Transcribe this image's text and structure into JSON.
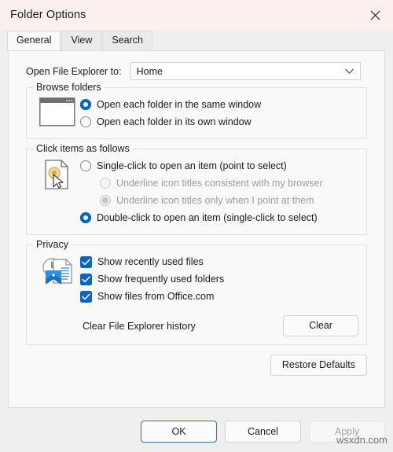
{
  "window": {
    "title": "Folder Options",
    "close_icon": "close-icon",
    "titlebar_color": "#fbf0ee"
  },
  "tabs": [
    {
      "label": "General",
      "active": true
    },
    {
      "label": "View",
      "active": false
    },
    {
      "label": "Search",
      "active": false
    }
  ],
  "general": {
    "open_explorer": {
      "label": "Open File Explorer to:",
      "value": "Home",
      "chevron_icon": "chevron-down-icon"
    },
    "browse_folders": {
      "legend": "Browse folders",
      "icon": "window-folder-icon",
      "options": [
        {
          "label": "Open each folder in the same window",
          "checked": true,
          "disabled": false
        },
        {
          "label": "Open each folder in its own window",
          "checked": false,
          "disabled": false
        }
      ]
    },
    "click_items": {
      "legend": "Click items as follows",
      "icon": "document-pointer-icon",
      "options": [
        {
          "label": "Single-click to open an item (point to select)",
          "checked": false,
          "disabled": false,
          "indent": false
        },
        {
          "label": "Underline icon titles consistent with my browser",
          "checked": false,
          "disabled": true,
          "indent": true
        },
        {
          "label": "Underline icon titles only when I point at them",
          "checked": true,
          "disabled": true,
          "indent": true
        },
        {
          "label": "Double-click to open an item (single-click to select)",
          "checked": true,
          "disabled": false,
          "indent": false
        }
      ]
    },
    "privacy": {
      "legend": "Privacy",
      "icon": "recent-files-pin-icon",
      "checkboxes": [
        {
          "label": "Show recently used files",
          "checked": true
        },
        {
          "label": "Show frequently used folders",
          "checked": true
        },
        {
          "label": "Show files from Office.com",
          "checked": true
        }
      ],
      "clear_history": {
        "label": "Clear File Explorer history",
        "button": "Clear"
      }
    },
    "restore_defaults": "Restore Defaults"
  },
  "footer": {
    "ok": "OK",
    "cancel": "Cancel",
    "apply": "Apply",
    "apply_disabled": true
  },
  "watermark": "wsxdn.com",
  "colors": {
    "accent": "#0a64c2",
    "panel": "#f9f9f9",
    "dialog": "#efefef",
    "disabled_text": "#9b9b9b"
  }
}
